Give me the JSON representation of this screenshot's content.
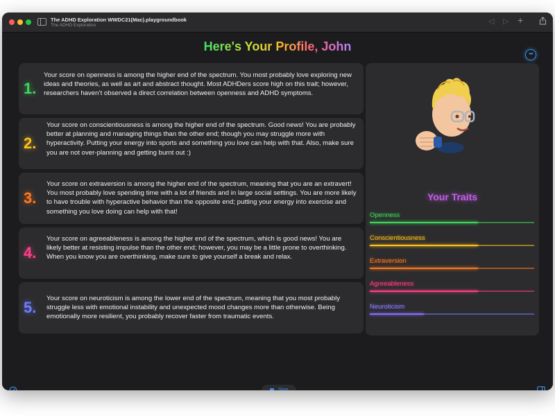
{
  "window": {
    "title": "The ADHD Exploration WWDC21(Mac).playgroundbook",
    "subtitle": "The ADHD Exploration",
    "toolbar_icons": [
      "chevron-left-icon",
      "chevron-right-icon",
      "plus-icon",
      "share-icon"
    ]
  },
  "header": {
    "title": "Here's Your Profile, John",
    "more_icon": "ellipsis-circle-icon"
  },
  "cards": [
    {
      "number": "1.",
      "color": "#3ed75a",
      "text": "Your score on openness is among the higher end of the spectrum. You most probably love exploring new ideas and theories, as well as art and abstract thought. Most ADHDers score high on this trait; however, researchers haven’t observed a direct correlation between openness and ADHD symptoms."
    },
    {
      "number": "2.",
      "color": "#ffc21a",
      "text": "Your score on conscientiousness is among the higher end of the spectrum. Good news! You are probably better at planning and managing things than the other end; though you may struggle more with hyperactivity. Putting your energy into sports and something you love can help with that. Also, make sure you are not over-planning and getting burnt out :)"
    },
    {
      "number": "3.",
      "color": "#ff7a1f",
      "text": "Your score on extraversion is among the higher end of the spectrum, meaning that you are an extravert! You most probably love spending time with a lot of friends and in large social settings. You are more likely to have trouble with hyperactive behavior than the opposite end; putting your energy into exercise and something you love doing can help with that!"
    },
    {
      "number": "4.",
      "color": "#ff3f88",
      "text": "Your score on agreeableness is among the higher end of the spectrum, which is good news! You are likely better at resisting impulse than the other end; however, you may be a little prone to overthinking. When you know you are overthinking, make sure to give yourself a break and relax."
    },
    {
      "number": "5.",
      "color": "#6e7dff",
      "text": "Your score on neuroticism is among the lower end of the spectrum, meaning that you most probably struggle less with emotional instability and unexpected mood changes more than otherwise. Being emotionally more resilient, you probably recover faster from traumatic events."
    }
  ],
  "profile": {
    "avatar_icon": "memoji-avatar",
    "traits_title": "Your Traits",
    "traits": [
      {
        "label": "Openness",
        "color": "#3ed75a",
        "level": 0.66
      },
      {
        "label": "Conscientiousness",
        "color": "#ffc21a",
        "level": 0.66
      },
      {
        "label": "Extraversion",
        "color": "#ff7a1f",
        "level": 0.66
      },
      {
        "label": "Agreeableness",
        "color": "#ff3f88",
        "level": 0.66
      },
      {
        "label": "Neuroticism",
        "color": "#6e7dff",
        "level": 0.33
      }
    ]
  },
  "bottom_bar": {
    "stop_label": "Stop",
    "left_icon": "speedometer-icon",
    "right_icon": "sidebar-right-icon"
  }
}
